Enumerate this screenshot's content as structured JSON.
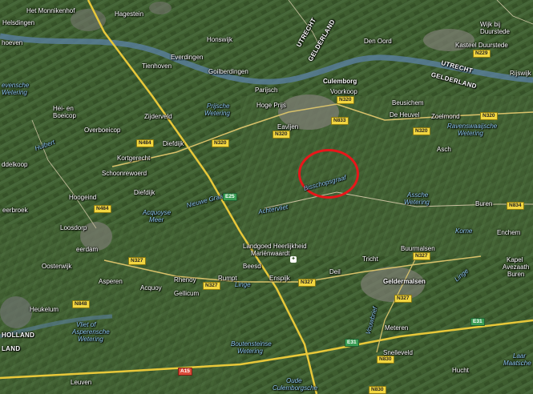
{
  "map": {
    "places": {
      "het_monnikenhof": "Het Monnikenhof",
      "hagestein": "Hagestein",
      "helsdingen": "Helsdingen",
      "hoeven": "hoeven",
      "honswijk": "Honswijk",
      "everdingen": "Everdingen",
      "tienhoven": "Tienhoven",
      "goilberdingen": "Goilberdingen",
      "den_oord": "Den Oord",
      "wijk_bij_duurstede_1": "Wijk bij",
      "wijk_bij_duurstede_2": "Duurstede",
      "kasteel_duurstede": "Kasteel Duurstede",
      "rijswijk": "Rijswijk",
      "parijsch": "Parijsch",
      "culemborg": "Culemborg",
      "voorkoop": "Voorkoop",
      "hoge_prijs": "Hoge Prijs",
      "beusichem": "Beusichem",
      "heien_1": "Hei- en",
      "heien_2": "Boeicop",
      "zijderveld": "Zijderveld",
      "overboeicop": "Overboeicop",
      "de_heuvel": "De Heuvel",
      "zoelmond": "Zoelmond",
      "diefdijk_1": "Diefdijk",
      "eavijen": "Eavijen",
      "ddelkoop": "ddelkoop",
      "kortgerecht": "Kortgerecht",
      "schoonrewoerd": "Schoonrewoerd",
      "asch": "Asch",
      "bisschopsgraaf": "Bisschopsgraaf",
      "diefdijk_2": "Diefdijk",
      "hoogeind": "Hoogeind",
      "eerbroek": "eerbroek",
      "buren": "Buren",
      "loosdorp": "Loosdorp",
      "achterveld": "Achtervliet",
      "enchem": "Enchem",
      "eerdam": "eerdam",
      "landgoed_1": "Landgoed Heerlijkheid",
      "landgoed_2": "Mariënwaardt",
      "buurmalsen": "Buurmalsen",
      "kapel_1": "Kapel",
      "kapel_2": "Avezaath",
      "kapel_3": "Buren",
      "beesd": "Beesd",
      "tricht": "Tricht",
      "oosterwijk": "Oosterwijk",
      "asperen": "Asperen",
      "acquoy": "Acquoy",
      "rhenoy": "Rhenoy",
      "rumpt": "Rumpt",
      "enspijk": "Enspijk",
      "deil": "Deil",
      "geldermalsen": "Geldermalsen",
      "heukelum": "Heukelum",
      "gellicum": "Gellicum",
      "meteren": "Meteren",
      "snelleveld": "Snelleveld",
      "hucht": "Hucht",
      "leuven": "Leuven",
      "holland": "HOLLAND",
      "land": "LAND"
    },
    "water": {
      "revensche": "evensche",
      "wetering_w": "Wetering",
      "hulbert": "Hulbert",
      "prijsche_1": "Prijsche",
      "prijsche_2": "Wetering",
      "ravenswaaijsche_1": "Ravenswaaijsche",
      "ravenswaaijsche_2": "Wetering",
      "nieuwe_graaf": "Nieuwe Graaf",
      "acquoyse_1": "Acquoyse",
      "acquoyse_2": "Meer",
      "assche_1": "Assche",
      "assche_2": "Wetering",
      "korne": "Korne",
      "linge_1": "Linge",
      "linge_2": "Linge",
      "vliet_1": "Vliet of",
      "vliet_2": "Asperensche",
      "vliet_3": "Wetering",
      "boutensteinse_1": "Boutensteinse",
      "boutensteinse_2": "Wetering",
      "oude_1": "Oude",
      "oude_2": "Culemborgsche",
      "vouwbrief": "Vouwbrief",
      "waalbandijk_1": "Laar",
      "waalbandijk_2": "Maatsche"
    },
    "provinces": {
      "utrecht_top": "UTRECHT",
      "gelderland_top": "GELDERLAND",
      "utrecht_right": "UTRECHT",
      "gelderland_right": "GELDERLAND"
    },
    "roads": {
      "n229": "N229",
      "n320_a": "N320",
      "n320_b": "N320",
      "n320_c": "N320",
      "n320_d": "N320",
      "n320_e": "N320",
      "n833": "N833",
      "n484_a": "N484",
      "n484_b": "N484",
      "n327_a": "N327",
      "n327_b": "N327",
      "n327_c": "N327",
      "n327_d": "N327",
      "n327_e": "N327",
      "n848": "N848",
      "n834": "N834",
      "n830_a": "N830",
      "n830_b": "N830",
      "e25": "E25",
      "e31_a": "E31",
      "e31_b": "E31",
      "a15": "A15"
    },
    "colors": {
      "terrain": "#3d5a2f",
      "river": "#5a7fa0",
      "motorway": "#e8c83a",
      "marker": "#e8161a"
    },
    "highlight_marker": "red circle around Bisschopsgraaf"
  }
}
